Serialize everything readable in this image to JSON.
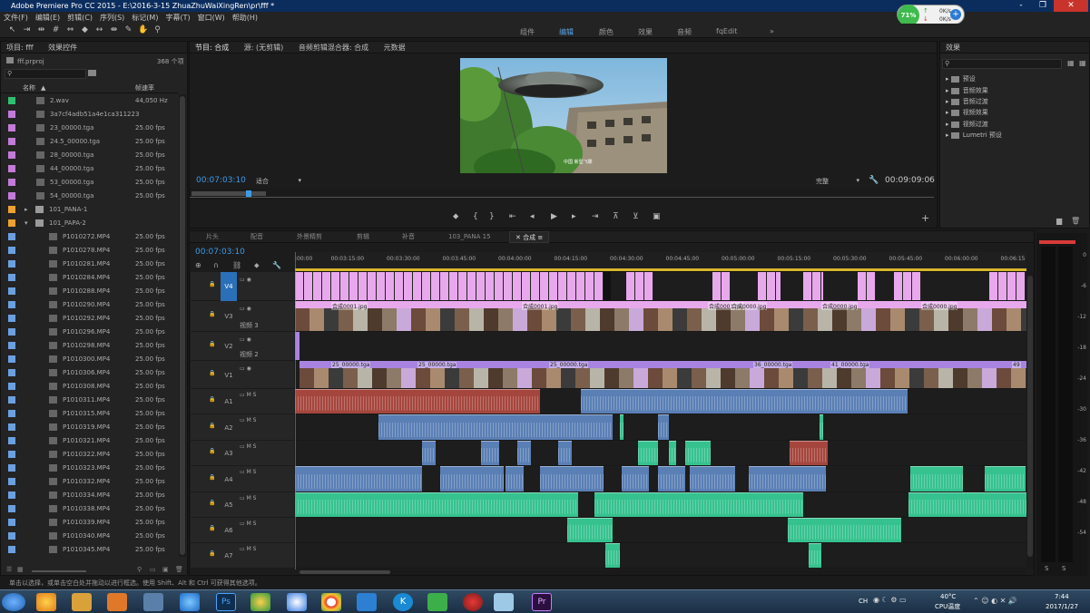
{
  "title": "Adobe Premiere Pro CC 2015 - E:\\2016-3-15 ZhuaZhuWaiXingRen\\pr\\fff *",
  "window_buttons": [
    "-",
    "❐",
    "✕"
  ],
  "menu": [
    "文件(F)",
    "编辑(E)",
    "剪辑(C)",
    "序列(S)",
    "标记(M)",
    "字幕(T)",
    "窗口(W)",
    "帮助(H)"
  ],
  "workspaces": [
    "组件",
    "编辑",
    "颜色",
    "效果",
    "音频",
    "fqEdit",
    "»"
  ],
  "active_workspace": "编辑",
  "net": {
    "percent": "71%",
    "up": "0K/s",
    "down": "0K/s"
  },
  "project": {
    "tabs": [
      "项目: fff",
      "效果控件"
    ],
    "file": "fff.prproj",
    "count": "368 个项",
    "col_name": "名称",
    "col_rate": "帧速率",
    "rows": [
      {
        "name": "2.wav",
        "rate": "44,050 Hz",
        "color": "#2fbf71",
        "indent": 1,
        "folder": false
      },
      {
        "name": "3a7cf4adb51a4e1ca311223",
        "rate": "",
        "color": "#c27bd8",
        "indent": 1,
        "folder": false
      },
      {
        "name": "23_00000.tga",
        "rate": "25.00 fps",
        "color": "#c27bd8",
        "indent": 1,
        "folder": false
      },
      {
        "name": "24.5_00000.tga",
        "rate": "25.00 fps",
        "color": "#c27bd8",
        "indent": 1,
        "folder": false
      },
      {
        "name": "28_00000.tga",
        "rate": "25.00 fps",
        "color": "#c27bd8",
        "indent": 1,
        "folder": false
      },
      {
        "name": "44_00000.tga",
        "rate": "25.00 fps",
        "color": "#c27bd8",
        "indent": 1,
        "folder": false
      },
      {
        "name": "53_00000.tga",
        "rate": "25.00 fps",
        "color": "#c27bd8",
        "indent": 1,
        "folder": false
      },
      {
        "name": "54_00000.tga",
        "rate": "25.00 fps",
        "color": "#c27bd8",
        "indent": 1,
        "folder": false
      },
      {
        "name": "101_PANA-1",
        "rate": "",
        "color": "#f0a030",
        "indent": 0,
        "folder": true
      },
      {
        "name": "101_PAPA-2",
        "rate": "",
        "color": "#f0a030",
        "indent": 0,
        "folder": true
      },
      {
        "name": "P1010272.MP4",
        "rate": "25.00 fps",
        "color": "#6aa0e0",
        "indent": 2,
        "folder": false
      },
      {
        "name": "P1010278.MP4",
        "rate": "25.00 fps",
        "color": "#6aa0e0",
        "indent": 2,
        "folder": false
      },
      {
        "name": "P1010281.MP4",
        "rate": "25.00 fps",
        "color": "#6aa0e0",
        "indent": 2,
        "folder": false
      },
      {
        "name": "P1010284.MP4",
        "rate": "25.00 fps",
        "color": "#6aa0e0",
        "indent": 2,
        "folder": false
      },
      {
        "name": "P1010288.MP4",
        "rate": "25.00 fps",
        "color": "#6aa0e0",
        "indent": 2,
        "folder": false
      },
      {
        "name": "P1010290.MP4",
        "rate": "25.00 fps",
        "color": "#6aa0e0",
        "indent": 2,
        "folder": false
      },
      {
        "name": "P1010292.MP4",
        "rate": "25.00 fps",
        "color": "#6aa0e0",
        "indent": 2,
        "folder": false
      },
      {
        "name": "P1010296.MP4",
        "rate": "25.00 fps",
        "color": "#6aa0e0",
        "indent": 2,
        "folder": false
      },
      {
        "name": "P1010298.MP4",
        "rate": "25.00 fps",
        "color": "#6aa0e0",
        "indent": 2,
        "folder": false
      },
      {
        "name": "P1010300.MP4",
        "rate": "25.00 fps",
        "color": "#6aa0e0",
        "indent": 2,
        "folder": false
      },
      {
        "name": "P1010306.MP4",
        "rate": "25.00 fps",
        "color": "#6aa0e0",
        "indent": 2,
        "folder": false
      },
      {
        "name": "P1010308.MP4",
        "rate": "25.00 fps",
        "color": "#6aa0e0",
        "indent": 2,
        "folder": false
      },
      {
        "name": "P1010311.MP4",
        "rate": "25.00 fps",
        "color": "#6aa0e0",
        "indent": 2,
        "folder": false
      },
      {
        "name": "P1010315.MP4",
        "rate": "25.00 fps",
        "color": "#6aa0e0",
        "indent": 2,
        "folder": false
      },
      {
        "name": "P1010319.MP4",
        "rate": "25.00 fps",
        "color": "#6aa0e0",
        "indent": 2,
        "folder": false
      },
      {
        "name": "P1010321.MP4",
        "rate": "25.00 fps",
        "color": "#6aa0e0",
        "indent": 2,
        "folder": false
      },
      {
        "name": "P1010322.MP4",
        "rate": "25.00 fps",
        "color": "#6aa0e0",
        "indent": 2,
        "folder": false
      },
      {
        "name": "P1010323.MP4",
        "rate": "25.00 fps",
        "color": "#6aa0e0",
        "indent": 2,
        "folder": false
      },
      {
        "name": "P1010332.MP4",
        "rate": "25.00 fps",
        "color": "#6aa0e0",
        "indent": 2,
        "folder": false
      },
      {
        "name": "P1010334.MP4",
        "rate": "25.00 fps",
        "color": "#6aa0e0",
        "indent": 2,
        "folder": false
      },
      {
        "name": "P1010338.MP4",
        "rate": "25.00 fps",
        "color": "#6aa0e0",
        "indent": 2,
        "folder": false
      },
      {
        "name": "P1010339.MP4",
        "rate": "25.00 fps",
        "color": "#6aa0e0",
        "indent": 2,
        "folder": false
      },
      {
        "name": "P1010340.MP4",
        "rate": "25.00 fps",
        "color": "#6aa0e0",
        "indent": 2,
        "folder": false
      },
      {
        "name": "P1010345.MP4",
        "rate": "25.00 fps",
        "color": "#6aa0e0",
        "indent": 2,
        "folder": false
      }
    ]
  },
  "monitor": {
    "tabs": [
      "节目: 合成",
      "源: (无剪辑)",
      "音频剪辑混合器: 合成",
      "元数据"
    ],
    "timecode": "00:07:03:10",
    "fit": "适合",
    "quality": "完整",
    "duration": "00:09:09:06",
    "subtitle": "中国 新型飞碟"
  },
  "effects": {
    "title": "效果",
    "items": [
      "预设",
      "音频效果",
      "音频过渡",
      "视频效果",
      "视频过渡",
      "Lumetri 预设"
    ]
  },
  "timeline": {
    "tabs": [
      "片头",
      "配音",
      "外景精剪",
      "剪辑",
      "补音",
      "103_PANA 15",
      "合成"
    ],
    "active_tab": "合成",
    "timecode": "00:07:03:10",
    "ruler": [
      ":00:00",
      "00:03:15:00",
      "00:03:30:00",
      "00:03:45:00",
      "00:04:00:00",
      "00:04:15:00",
      "00:04:30:00",
      "00:04:45:00",
      "00:05:00:00",
      "00:05:15:00",
      "00:05:30:00",
      "00:05:45:00",
      "00:06:00:00",
      "00:06:15"
    ],
    "tracks": [
      {
        "id": "V4",
        "type": "video",
        "label": ""
      },
      {
        "id": "V3",
        "type": "video",
        "label": "视频 3"
      },
      {
        "id": "V2",
        "type": "video",
        "label": "视频 2"
      },
      {
        "id": "V1",
        "type": "video",
        "label": ""
      },
      {
        "id": "A1",
        "type": "audio",
        "label": ""
      },
      {
        "id": "A2",
        "type": "audio",
        "label": ""
      },
      {
        "id": "A3",
        "type": "audio",
        "label": ""
      },
      {
        "id": "A4",
        "type": "audio",
        "label": ""
      },
      {
        "id": "A5",
        "type": "audio",
        "label": ""
      },
      {
        "id": "A6",
        "type": "audio",
        "label": ""
      },
      {
        "id": "A7",
        "type": "audio",
        "label": ""
      }
    ],
    "clip_labels": [
      "合成0001.jpg",
      "合成0001.jpg",
      "合成0001.jpg",
      "合成0000.jpg",
      "合成0000.jpg",
      "合成0000.jpg",
      "25_00000.tga",
      "25_00000.tga",
      "25_00000.tga",
      "36_00000.tga",
      "41_00000.tga",
      "49"
    ],
    "colors": {
      "video_pink": "#e8a9ec",
      "video_purple": "#a884e0",
      "audio_red": "#a5463e",
      "audio_blue": "#5a7fb5",
      "audio_teal": "#36c28f"
    }
  },
  "meter": {
    "scale": [
      "0",
      "-6",
      "-12",
      "-18",
      "-24",
      "-30",
      "-36",
      "-42",
      "-48",
      "-54"
    ],
    "solo": [
      "S",
      "S"
    ]
  },
  "status": "单击以选择，或单击空白处并拖动以进行框选。使用 Shift、Alt 和 Ctrl 可获得其他选项。",
  "taskbar": {
    "lang": "CH",
    "temp": "40°C",
    "temp_label": "CPU温度",
    "time": "7:44",
    "date": "2017/1/27"
  }
}
